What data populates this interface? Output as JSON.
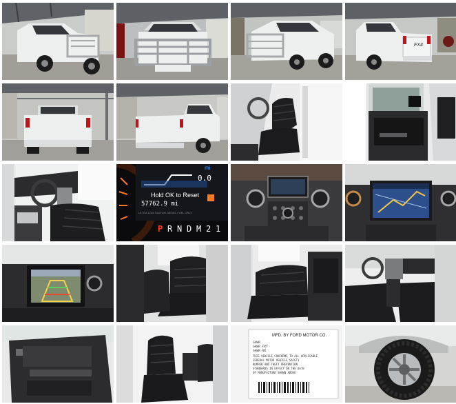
{
  "gallery": {
    "tiles": [
      {
        "id": 1,
        "subject": "front-three-quarter"
      },
      {
        "id": 2,
        "subject": "front-grille-guard"
      },
      {
        "id": 3,
        "subject": "front-passenger-side"
      },
      {
        "id": 4,
        "subject": "rear-three-quarter"
      },
      {
        "id": 5,
        "subject": "rear-under-carport"
      },
      {
        "id": 6,
        "subject": "rear-quarter-carport"
      },
      {
        "id": 7,
        "subject": "driver-seat"
      },
      {
        "id": 8,
        "subject": "open-door-interior"
      },
      {
        "id": 9,
        "subject": "dashboard-cabin"
      },
      {
        "id": 10,
        "subject": "instrument-cluster"
      },
      {
        "id": 11,
        "subject": "center-console-controls"
      },
      {
        "id": 12,
        "subject": "navigation-screen"
      },
      {
        "id": 13,
        "subject": "backup-camera"
      },
      {
        "id": 14,
        "subject": "rear-seats"
      },
      {
        "id": 15,
        "subject": "rear-seats-side"
      },
      {
        "id": 16,
        "subject": "front-cabin-side"
      },
      {
        "id": 17,
        "subject": "door-panel"
      },
      {
        "id": 18,
        "subject": "front-seats"
      },
      {
        "id": 19,
        "subject": "door-label"
      },
      {
        "id": 20,
        "subject": "wheel-tire"
      }
    ]
  },
  "cluster": {
    "odometer": "57762.9 mi",
    "reset_hint": "Hold OK to Reset",
    "top_value": "0.0",
    "gear_indicator": [
      "P",
      "R",
      "N",
      "D",
      "M",
      "2",
      "1"
    ],
    "fuel_label": "ULTRA LOW SULFUR DIESEL FUEL ONLY"
  },
  "tailgate_badge": "FX4",
  "door_label": {
    "header": "MFD. BY FORD MOTOR CO.",
    "lines": [
      "GVWR",
      "GAWR FRT",
      "GAWR RR",
      "THIS VEHICLE CONFORMS TO ALL APPLICABLE",
      "FEDERAL MOTOR VEHICLE SAFETY",
      "BUMPER AND THEFT PREVENTION",
      "STANDARDS IN EFFECT ON THE DATE",
      "OF MANUFACTURE SHOWN ABOVE"
    ]
  },
  "colors": {
    "truck_white": "#eef0f0",
    "leather_black": "#1c1c1e",
    "carport_roof": "#5e6266",
    "ground": "#9d9c97",
    "cluster_orange": "#ff7a1a",
    "screen_blue": "#2d4f8c"
  }
}
